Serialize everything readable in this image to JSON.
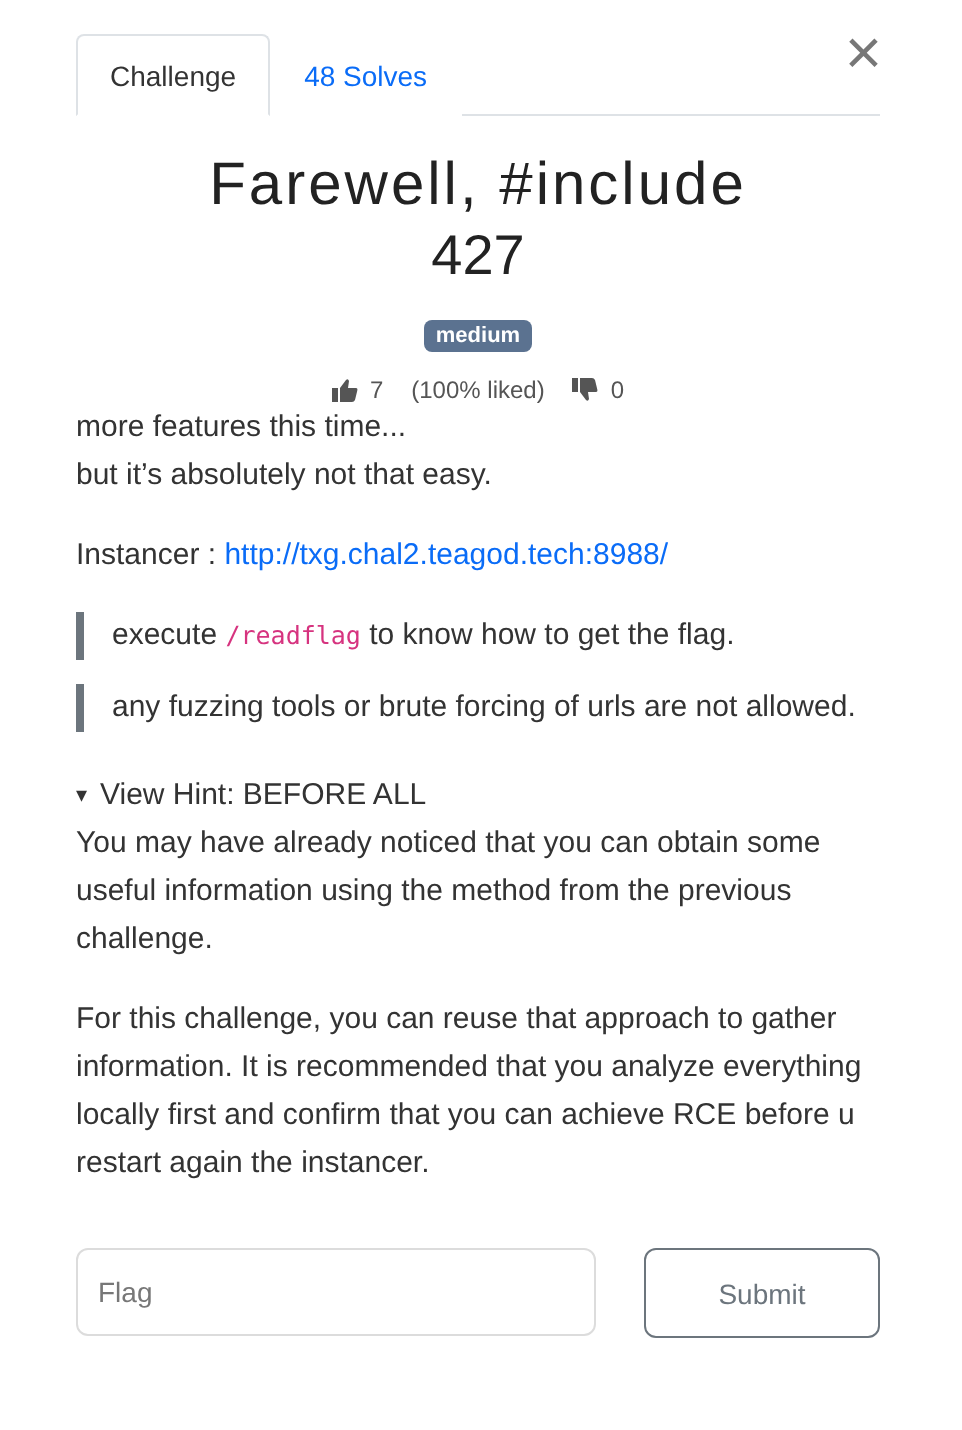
{
  "tabs": [
    {
      "label": "Challenge",
      "selected": true
    },
    {
      "label": "48 Solves",
      "selected": false
    }
  ],
  "close": "×",
  "title": "Farewell, #include",
  "points": "427",
  "badge": "medium",
  "votes": {
    "likes": "7",
    "ratio": "(100% liked)",
    "dislikes": "0"
  },
  "description": [
    "more features this time...",
    "but it’s absolutely not that easy."
  ],
  "instancer": {
    "label": "Instancer :",
    "link": "http://txg.chal2.teagod.tech:8988/"
  },
  "quotes": [
    {
      "before": "execute ",
      "code": "/readflag",
      "after": " to know how to get the flag."
    },
    {
      "before": "any fuzzing tools or brute forcing of urls are not allowed."
    }
  ],
  "hint": {
    "marker": "▾",
    "summary": "View Hint: BEFORE ALL",
    "expanded": true,
    "paragraphs": [
      "You may have already noticed that you can obtain some useful information using the method from the previous challenge.",
      "For this challenge, you can reuse that approach to gather information. It is recommended that you analyze everything locally first and confirm that you can achieve RCE before u restart again the instancer."
    ]
  },
  "flag": {
    "placeholder": "Flag"
  },
  "submit": "Submit"
}
